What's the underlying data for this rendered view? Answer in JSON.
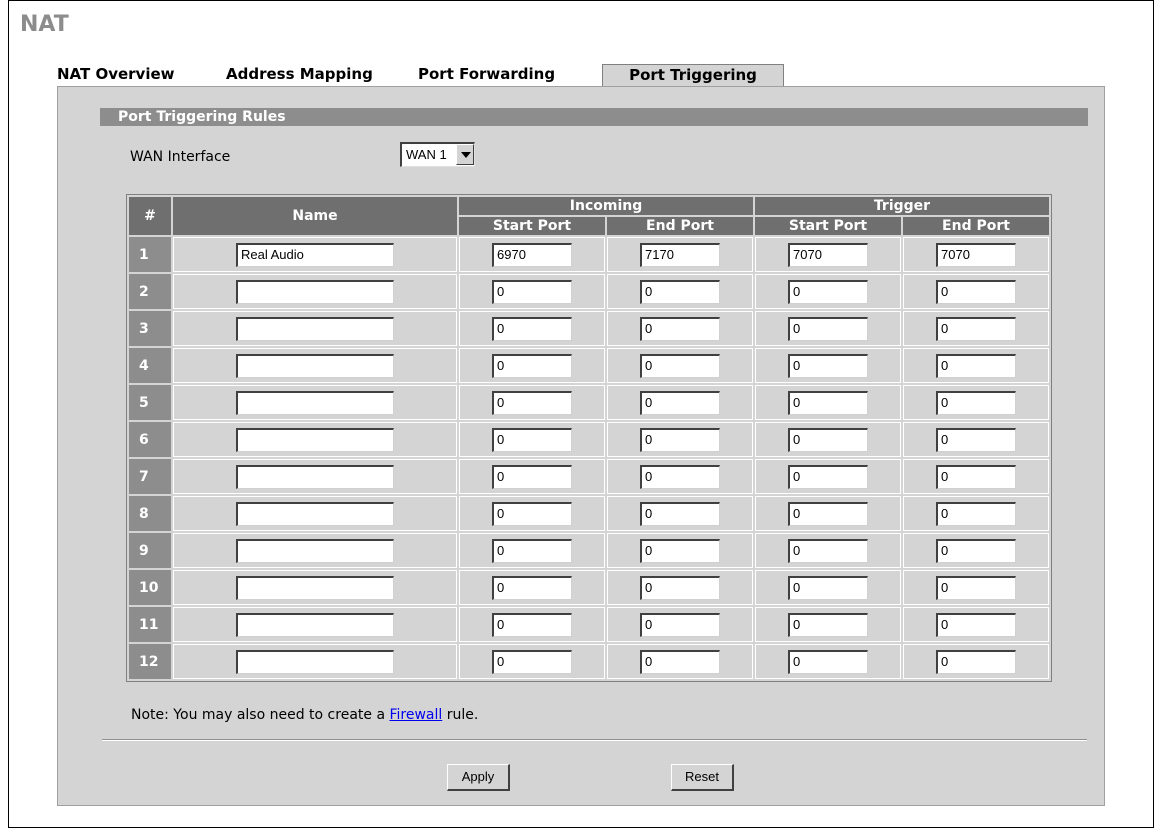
{
  "page_title": "NAT",
  "tabs": [
    {
      "label": "NAT Overview"
    },
    {
      "label": "Address Mapping"
    },
    {
      "label": "Port Forwarding"
    },
    {
      "label": "Port Triggering",
      "active": true
    }
  ],
  "section_title": "Port Triggering Rules",
  "wan_interface": {
    "label": "WAN Interface",
    "selected": "WAN 1"
  },
  "table": {
    "headers": {
      "num": "#",
      "name": "Name",
      "incoming": "Incoming",
      "trigger": "Trigger",
      "start_port": "Start Port",
      "end_port": "End Port"
    },
    "rows": [
      {
        "num": "1",
        "name": "Real Audio",
        "in_start": "6970",
        "in_end": "7170",
        "tr_start": "7070",
        "tr_end": "7070"
      },
      {
        "num": "2",
        "name": "",
        "in_start": "0",
        "in_end": "0",
        "tr_start": "0",
        "tr_end": "0"
      },
      {
        "num": "3",
        "name": "",
        "in_start": "0",
        "in_end": "0",
        "tr_start": "0",
        "tr_end": "0"
      },
      {
        "num": "4",
        "name": "",
        "in_start": "0",
        "in_end": "0",
        "tr_start": "0",
        "tr_end": "0"
      },
      {
        "num": "5",
        "name": "",
        "in_start": "0",
        "in_end": "0",
        "tr_start": "0",
        "tr_end": "0"
      },
      {
        "num": "6",
        "name": "",
        "in_start": "0",
        "in_end": "0",
        "tr_start": "0",
        "tr_end": "0"
      },
      {
        "num": "7",
        "name": "",
        "in_start": "0",
        "in_end": "0",
        "tr_start": "0",
        "tr_end": "0"
      },
      {
        "num": "8",
        "name": "",
        "in_start": "0",
        "in_end": "0",
        "tr_start": "0",
        "tr_end": "0"
      },
      {
        "num": "9",
        "name": "",
        "in_start": "0",
        "in_end": "0",
        "tr_start": "0",
        "tr_end": "0"
      },
      {
        "num": "10",
        "name": "",
        "in_start": "0",
        "in_end": "0",
        "tr_start": "0",
        "tr_end": "0"
      },
      {
        "num": "11",
        "name": "",
        "in_start": "0",
        "in_end": "0",
        "tr_start": "0",
        "tr_end": "0"
      },
      {
        "num": "12",
        "name": "",
        "in_start": "0",
        "in_end": "0",
        "tr_start": "0",
        "tr_end": "0"
      }
    ]
  },
  "note": {
    "prefix": "Note: You may also need to create a ",
    "link": "Firewall",
    "suffix": " rule."
  },
  "buttons": {
    "apply": "Apply",
    "reset": "Reset"
  }
}
